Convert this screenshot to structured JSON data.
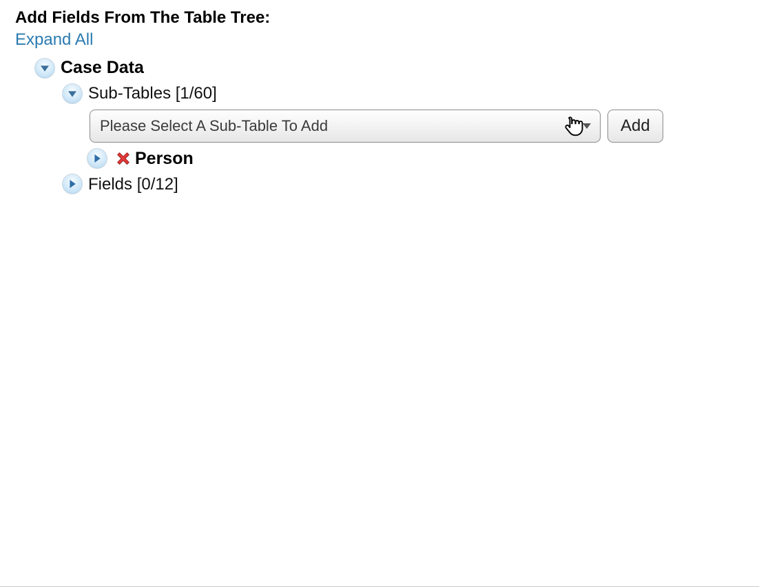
{
  "header": {
    "title": "Add Fields From The Table Tree:",
    "expand_all_label": "Expand All"
  },
  "tree": {
    "root": {
      "label": "Case Data",
      "expanded": true
    },
    "sub_tables": {
      "label": "Sub-Tables",
      "count_current": 1,
      "count_total": 60,
      "display": "Sub-Tables [1/60]",
      "expanded": true,
      "select_placeholder": "Please Select A Sub-Table To Add",
      "add_label": "Add",
      "items": [
        {
          "label": "Person",
          "expanded": false
        }
      ]
    },
    "fields": {
      "label": "Fields",
      "count_current": 0,
      "count_total": 12,
      "display": "Fields [0/12]",
      "expanded": false
    }
  }
}
